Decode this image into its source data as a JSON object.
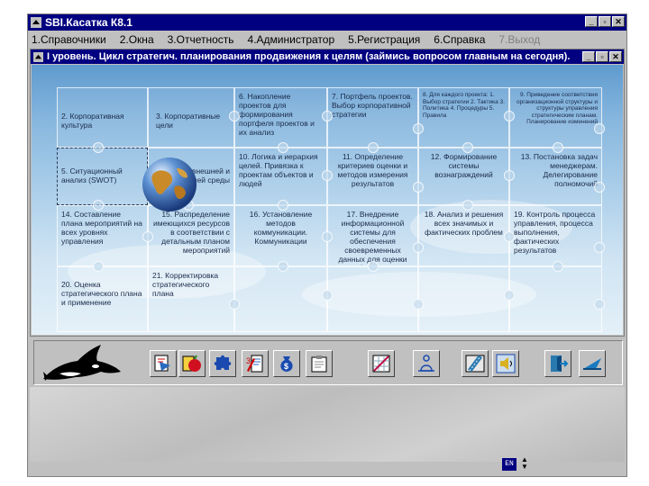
{
  "window": {
    "title": "SBI.Касатка К8.1"
  },
  "menu": [
    {
      "label": "1.Справочники",
      "disabled": false
    },
    {
      "label": "2.Окна",
      "disabled": false
    },
    {
      "label": "3.Отчетность",
      "disabled": false
    },
    {
      "label": "4.Администратор",
      "disabled": false
    },
    {
      "label": "5.Регистрация",
      "disabled": false
    },
    {
      "label": "6.Справка",
      "disabled": false
    },
    {
      "label": "7.Выход",
      "disabled": true
    }
  ],
  "child_window": {
    "title": "I уровень. Цикл стратегич. планирования продвижения к целям (займись вопросом главным на сегодня)."
  },
  "cells": [
    {
      "text": "2. Корпоративная культура"
    },
    {
      "text": "3. Корпоративные цели"
    },
    {
      "text": "6. Накопление проектов для формирования портфеля проектов и их анализ"
    },
    {
      "text": "7. Портфель проектов. Выбор корпоративной стратегии"
    },
    {
      "text": "8. Для каждого проекта: 1. Выбор стратегии 2. Тактика 3. Политика 4. Процедуры 5. Правила"
    },
    {
      "text": "9. Приведение соответствия организационной структуры и структуры управления стратегическим планам. Планирование изменений"
    },
    {
      "text": "5. Ситуационный анализ (SWOT)"
    },
    {
      "text": "4. Анализ внешней и внутренней среды"
    },
    {
      "text": "10. Логика и иерархия целей. Привязка к проектам объектов и людей"
    },
    {
      "text": "11. Определение критериев оценки и методов измерения результатов"
    },
    {
      "text": "12. Формирование системы вознаграждений"
    },
    {
      "text": "13. Постановка задач менеджерам. Делегирование полномочий"
    },
    {
      "text": "14. Составление плана мероприятий на всех уровнях управления"
    },
    {
      "text": "15. Распределение имеющихся ресурсов в соответствии с детальным планом мероприятий"
    },
    {
      "text": "16. Установление методов коммуникации. Коммуникации"
    },
    {
      "text": "17. Внедрение информационной системы для обеспечения своевременных данных для оценки бизнеса"
    },
    {
      "text": "18. Анализ и решения всех значимых и фактических проблем"
    },
    {
      "text": "19. Контроль процесса управления, процесса выполнения, фактических результатов"
    },
    {
      "text": "20. Оценка стратегического плана и применение"
    },
    {
      "text": "21. Корректировка стратегического плана"
    }
  ],
  "toolbar": {
    "buttons": [
      "report-icon",
      "apple-icon",
      "puzzle-icon",
      "document-pen-icon",
      "money-bag-icon",
      "notepad-icon",
      "chart-icon",
      "meditating-person-icon",
      "film-icon",
      "speaker-icon",
      "door-exit-icon",
      "arrow-icon"
    ]
  },
  "statusbar": {
    "lang": "EN"
  }
}
